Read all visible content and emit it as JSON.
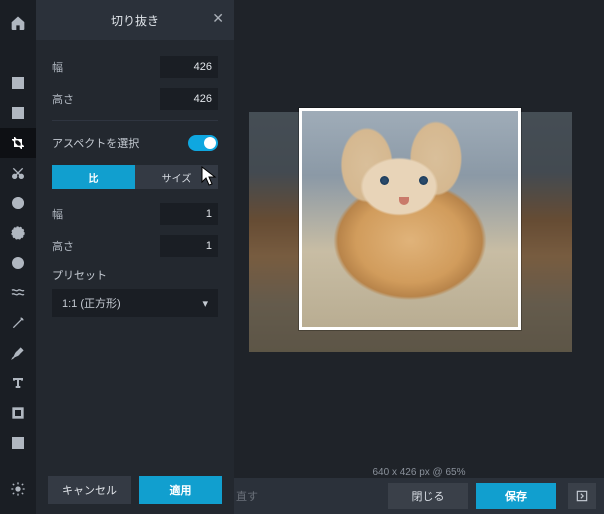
{
  "panel": {
    "title": "切り抜き",
    "width_label": "幅",
    "height_label": "高さ",
    "width_value": "426",
    "height_value": "426",
    "aspect_label": "アスペクトを選択",
    "seg_ratio": "比",
    "seg_size": "サイズ",
    "ratio_w_label": "幅",
    "ratio_h_label": "高さ",
    "ratio_w": "1",
    "ratio_h": "1",
    "preset_label": "プリセット",
    "preset_value": "1:1 (正方形)",
    "cancel": "キャンセル",
    "apply": "適用"
  },
  "canvas": {
    "status": "640 x 426 px @ 65%",
    "redo_fragment": "直す",
    "close": "閉じる",
    "save": "保存"
  }
}
